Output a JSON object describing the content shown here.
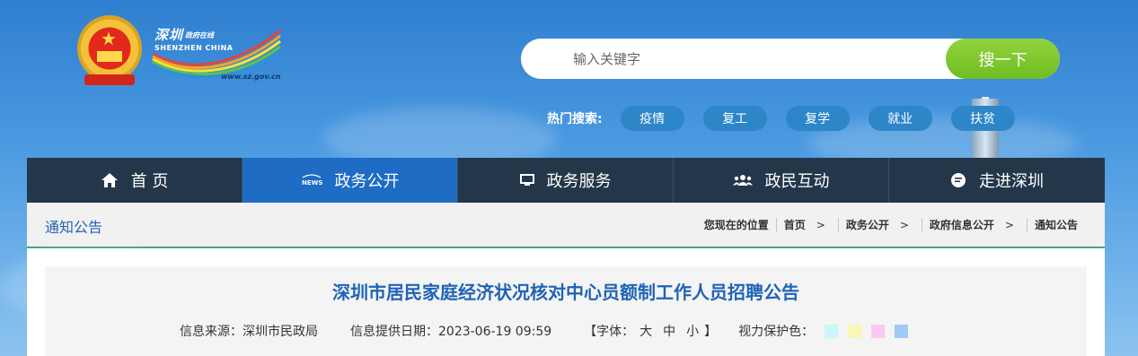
{
  "logo": {
    "cn_name": "深圳",
    "cn_sub": "政府在线",
    "en_name": "SHENZHEN CHINA",
    "url": "www.sz.gov.cn"
  },
  "search": {
    "placeholder": "输入关键字",
    "button_label": "搜一下"
  },
  "hot_search": {
    "label": "热门搜索:",
    "tags": [
      "疫情",
      "复工",
      "复学",
      "就业",
      "扶贫"
    ]
  },
  "nav": {
    "items": [
      {
        "label": "首 页",
        "icon": "home-icon"
      },
      {
        "label": "政务公开",
        "icon": "news-icon"
      },
      {
        "label": "政务服务",
        "icon": "monitor-icon"
      },
      {
        "label": "政民互动",
        "icon": "people-icon"
      },
      {
        "label": "走进深圳",
        "icon": "chat-icon"
      }
    ],
    "active_index": 1
  },
  "section": {
    "title": "通知公告"
  },
  "breadcrumb": {
    "prefix": "您现在的位置",
    "items": [
      "首页",
      "政务公开",
      "政府信息公开",
      "通知公告"
    ],
    "separator": ">"
  },
  "article": {
    "title": "深圳市居民家庭经济状况核对中心员额制工作人员招聘公告",
    "source": "信息来源：深圳市民政局",
    "date": "信息提供日期：2023-06-19 09:59",
    "font_label_open": "【字体：",
    "font_sizes": [
      "大",
      "中",
      "小"
    ],
    "font_label_close": "】",
    "eye_care_label": "视力保护色：",
    "eye_care_colors": [
      "#ccf6fb",
      "#f9f6b7",
      "#f9c8f4",
      "#9fcaf5"
    ]
  },
  "colors": {
    "nav_bg": "#24364a",
    "nav_active": "#1f6cc4",
    "search_button": "#7cc42b",
    "hot_tag": "#2d86c8",
    "title_blue": "#1f63b6",
    "divider_green": "#26a03b"
  }
}
